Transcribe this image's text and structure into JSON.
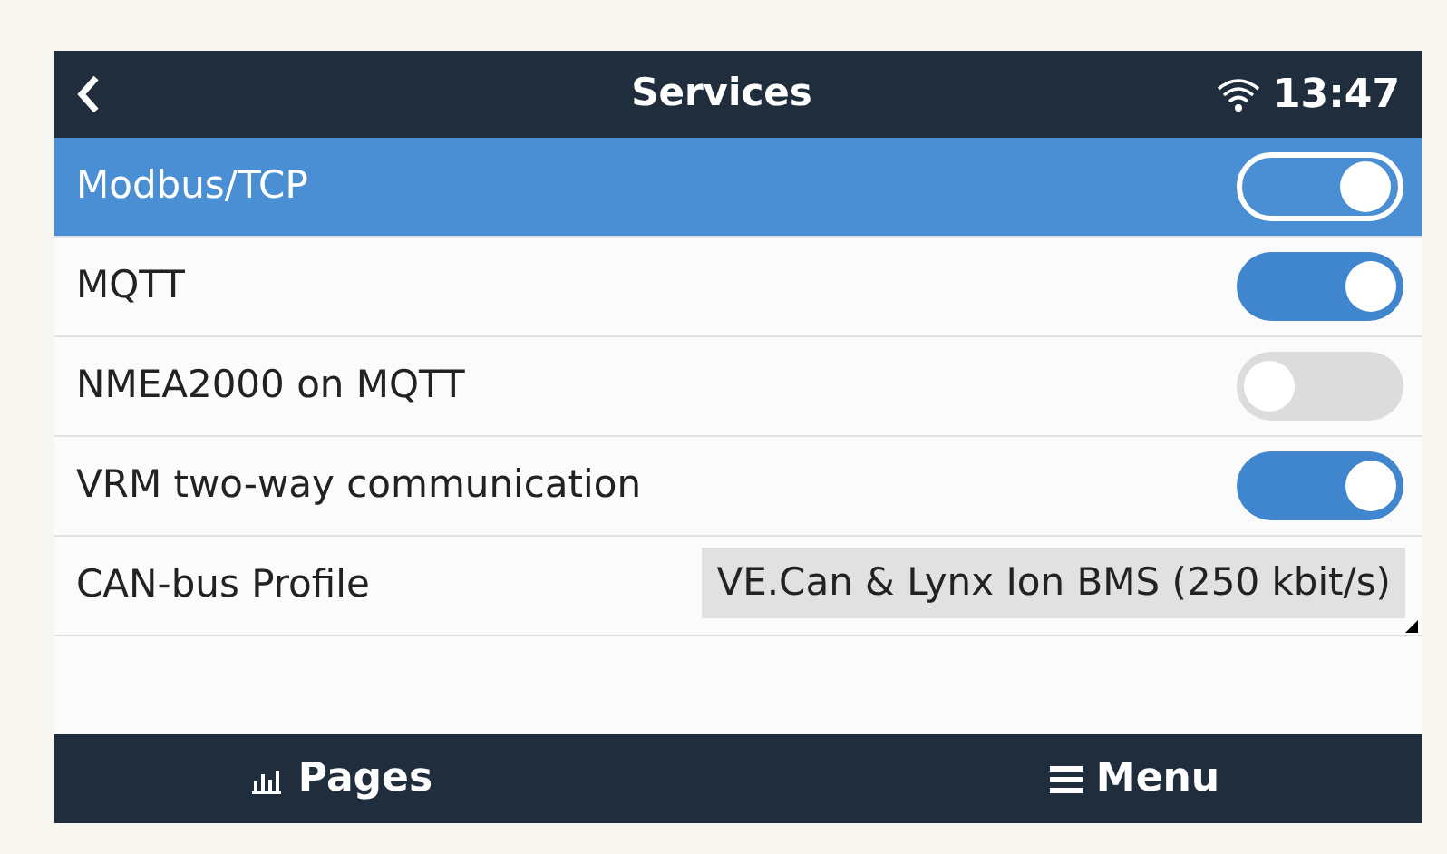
{
  "header": {
    "title": "Services",
    "time": "13:47"
  },
  "rows": [
    {
      "kind": "toggle",
      "label": "Modbus/TCP",
      "on": true,
      "selected": true
    },
    {
      "kind": "toggle",
      "label": "MQTT",
      "on": true,
      "selected": false
    },
    {
      "kind": "toggle",
      "label": "NMEA2000 on MQTT",
      "on": false,
      "selected": false
    },
    {
      "kind": "toggle",
      "label": "VRM two-way communication",
      "on": true,
      "selected": false
    },
    {
      "kind": "value",
      "label": "CAN-bus Profile",
      "value": "VE.Can & Lynx Ion BMS (250 kbit/s)",
      "selected": false
    }
  ],
  "footer": {
    "left": "Pages",
    "right": "Menu"
  }
}
